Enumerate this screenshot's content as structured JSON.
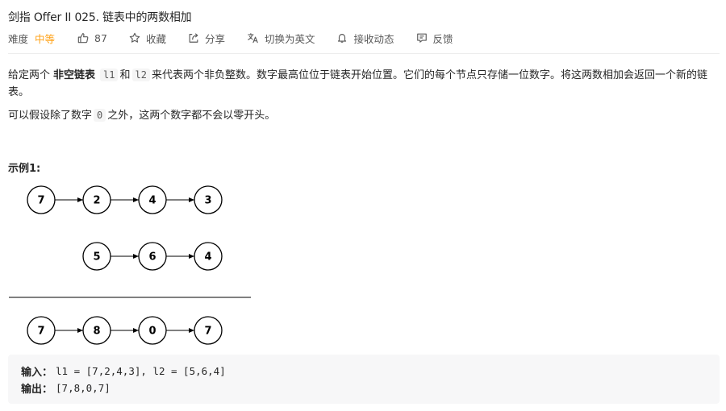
{
  "problem": {
    "title": "剑指 Offer II 025. 链表中的两数相加",
    "difficulty_label": "难度",
    "difficulty_value": "中等",
    "difficulty_color": "#ffa116"
  },
  "toolbar": {
    "likes_count": "87",
    "favorite_label": "收藏",
    "share_label": "分享",
    "translate_label": "切换为英文",
    "notify_label": "接收动态",
    "feedback_label": "反馈"
  },
  "description": {
    "p1_part1": "给定两个",
    "p1_strong": "非空链表",
    "p1_code1": "l1",
    "p1_part2": "和",
    "p1_code2": "l2",
    "p1_part3": "来代表两个非负整数。数字最高位位于链表开始位置。它们的每个节点只存储一位数字。将这两数相加会返回一个新的链表。",
    "p2_part1": "可以假设除了数字",
    "p2_code": "0",
    "p2_part2": "之外，这两个数字都不会以零开头。"
  },
  "example": {
    "title": "示例1:",
    "list1": [
      "7",
      "2",
      "4",
      "3"
    ],
    "list2": [
      "5",
      "6",
      "4"
    ],
    "result": [
      "7",
      "8",
      "0",
      "7"
    ],
    "input_label": "输入：",
    "input_value": "l1 = [7,2,4,3], l2 = [5,6,4]",
    "output_label": "输出：",
    "output_value": "[7,8,0,7]"
  }
}
